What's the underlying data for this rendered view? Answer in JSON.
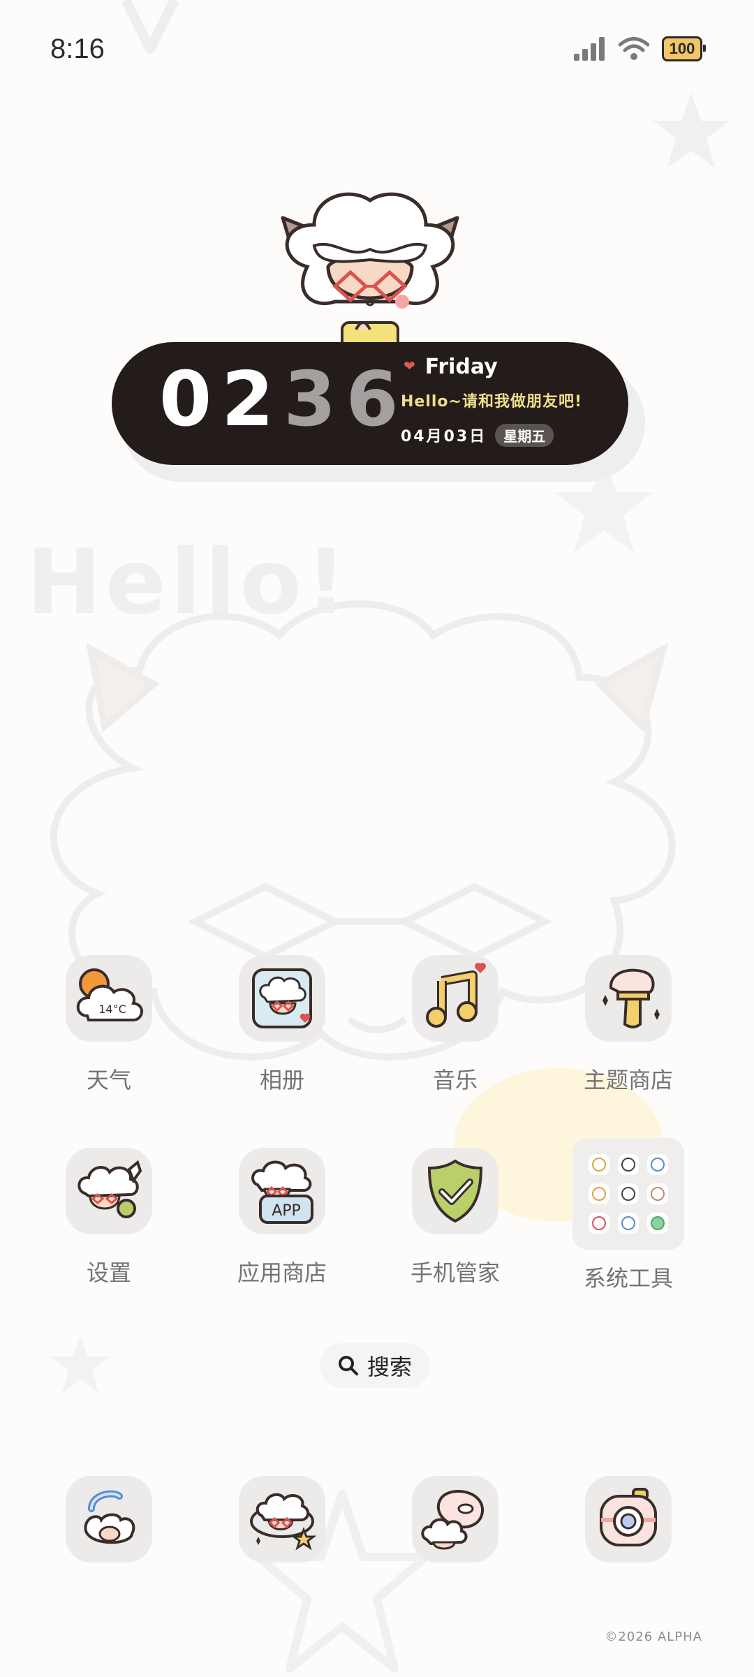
{
  "status_bar": {
    "time": "8:16",
    "battery": "100"
  },
  "background": {
    "hello_text": "Hello!"
  },
  "clock_widget": {
    "hours": "02",
    "minutes": "36",
    "day_name": "Friday",
    "greeting": "Hello~请和我做朋友吧!",
    "date": "04月03日",
    "weekday": "星期五"
  },
  "apps": [
    {
      "label": "天气",
      "icon": "weather-icon",
      "temp": "14°C"
    },
    {
      "label": "相册",
      "icon": "gallery-icon"
    },
    {
      "label": "音乐",
      "icon": "music-icon"
    },
    {
      "label": "主题商店",
      "icon": "theme-store-icon"
    },
    {
      "label": "设置",
      "icon": "settings-icon"
    },
    {
      "label": "应用商店",
      "icon": "app-store-icon",
      "badge": "APP"
    },
    {
      "label": "手机管家",
      "icon": "phone-manager-icon"
    },
    {
      "label": "系统工具",
      "icon": "system-tools-folder-icon"
    }
  ],
  "search": {
    "label": "搜索"
  },
  "dock": [
    {
      "icon": "phone-icon"
    },
    {
      "icon": "messages-icon"
    },
    {
      "icon": "browser-icon"
    },
    {
      "icon": "camera-icon"
    }
  ],
  "footer": {
    "copyright": "©2026 ALPHA"
  },
  "colors": {
    "widget_bg": "#231c1b",
    "accent_yellow": "#f3dc8a",
    "heart_red": "#e05a5a",
    "tile_bg": "#ecebea"
  }
}
